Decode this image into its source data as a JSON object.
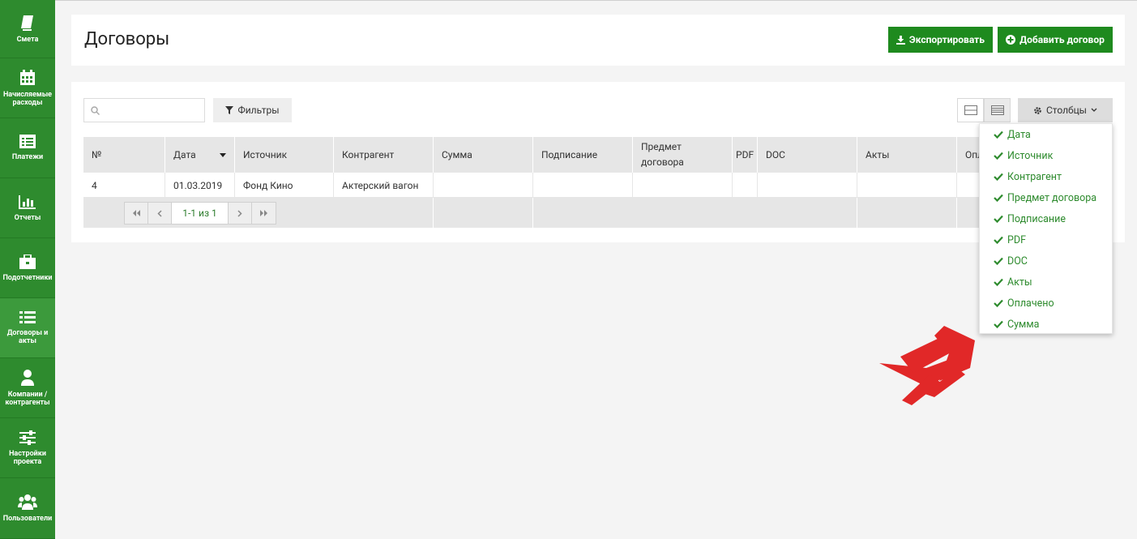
{
  "sidebar": {
    "items": [
      {
        "label": "Смета",
        "icon": "book-icon"
      },
      {
        "label": "Начисляемые расходы",
        "icon": "calendar-icon"
      },
      {
        "label": "Платежи",
        "icon": "list-alt-icon"
      },
      {
        "label": "Отчеты",
        "icon": "bar-chart-icon"
      },
      {
        "label": "Подотчетники",
        "icon": "briefcase-icon"
      },
      {
        "label": "Договоры и акты",
        "icon": "list-icon"
      },
      {
        "label": "Компании / контрагенты",
        "icon": "user-icon"
      },
      {
        "label": "Настройки проекта",
        "icon": "sliders-icon"
      },
      {
        "label": "Пользователи",
        "icon": "users-icon"
      }
    ],
    "active_index": 5
  },
  "header": {
    "title": "Договоры",
    "export_label": "Экспортировать",
    "add_label": "Добавить договор"
  },
  "toolbar": {
    "search_placeholder": "",
    "filters_label": "Фильтры",
    "columns_label": "Столбцы"
  },
  "table": {
    "headers": [
      "№",
      "Дата",
      "Источник",
      "Контрагент",
      "Сумма",
      "Подписание",
      "Предмет договора",
      "PDF",
      "DOC",
      "Акты",
      "Опл"
    ],
    "rows": [
      [
        "4",
        "01.03.2019",
        "Фонд Кино",
        "Актерский вагон",
        "",
        "",
        "",
        "",
        "",
        "",
        ""
      ]
    ],
    "sort_column": "Дата",
    "pagination": "1-1 из 1"
  },
  "columns_menu": {
    "items": [
      "Дата",
      "Источник",
      "Контрагент",
      "Предмет договора",
      "Подписание",
      "PDF",
      "DOC",
      "Акты",
      "Оплачено",
      "Сумма"
    ],
    "checked": [
      true,
      true,
      true,
      true,
      true,
      true,
      true,
      true,
      true,
      true
    ]
  },
  "colors": {
    "sidebar": "#2e8b2e",
    "accent_button": "#1e8a1e",
    "menu_text": "#2e8b2e",
    "arrow": "#e12828"
  }
}
